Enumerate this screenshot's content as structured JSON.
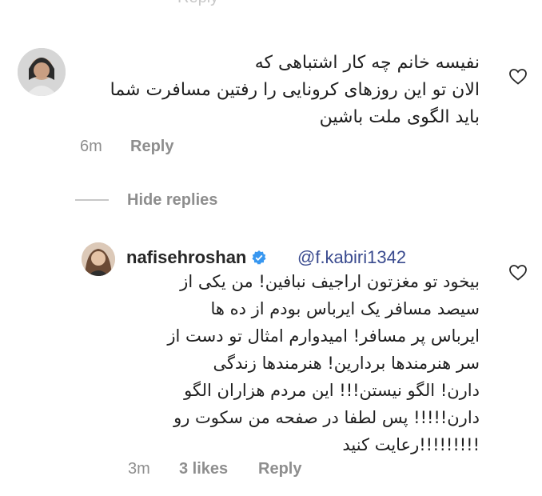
{
  "comment1": {
    "lines": [
      "نفیسه خانم چه کار اشتباهی که",
      "الان تو این روزهای کرونایی را رفتین مسافرت شما",
      "باید الگوی ملت باشین"
    ],
    "time": "6m",
    "reply_label": "Reply"
  },
  "hide_replies_label": "Hide replies",
  "comment2": {
    "username": "nafisehroshan",
    "mention": "@f.kabiri1342",
    "lines": [
      "بیخود تو مغزتون اراجیف نبافین! من یکی از",
      "سیصد مسافر یک ایرباس بودم از ده ها",
      "ایرباس پر مسافر! امیدوارم امثال تو دست از",
      "سر هنرمندها بردارین! هنرمندها زندگی",
      "دارن! الگو نیستن!!! این مردم هزاران الگو",
      "دارن!!!!! پس لطفا در صفحه من سکوت رو",
      "!!!!!!!!!رعایت کنید"
    ],
    "time": "3m",
    "likes": "3 likes",
    "reply_label": "Reply"
  },
  "colors": {
    "muted": "#8e8e8e",
    "mention": "#3a4b8f",
    "verified": "#3897f0"
  },
  "icons": [
    "heart-icon",
    "verified-badge-icon"
  ]
}
